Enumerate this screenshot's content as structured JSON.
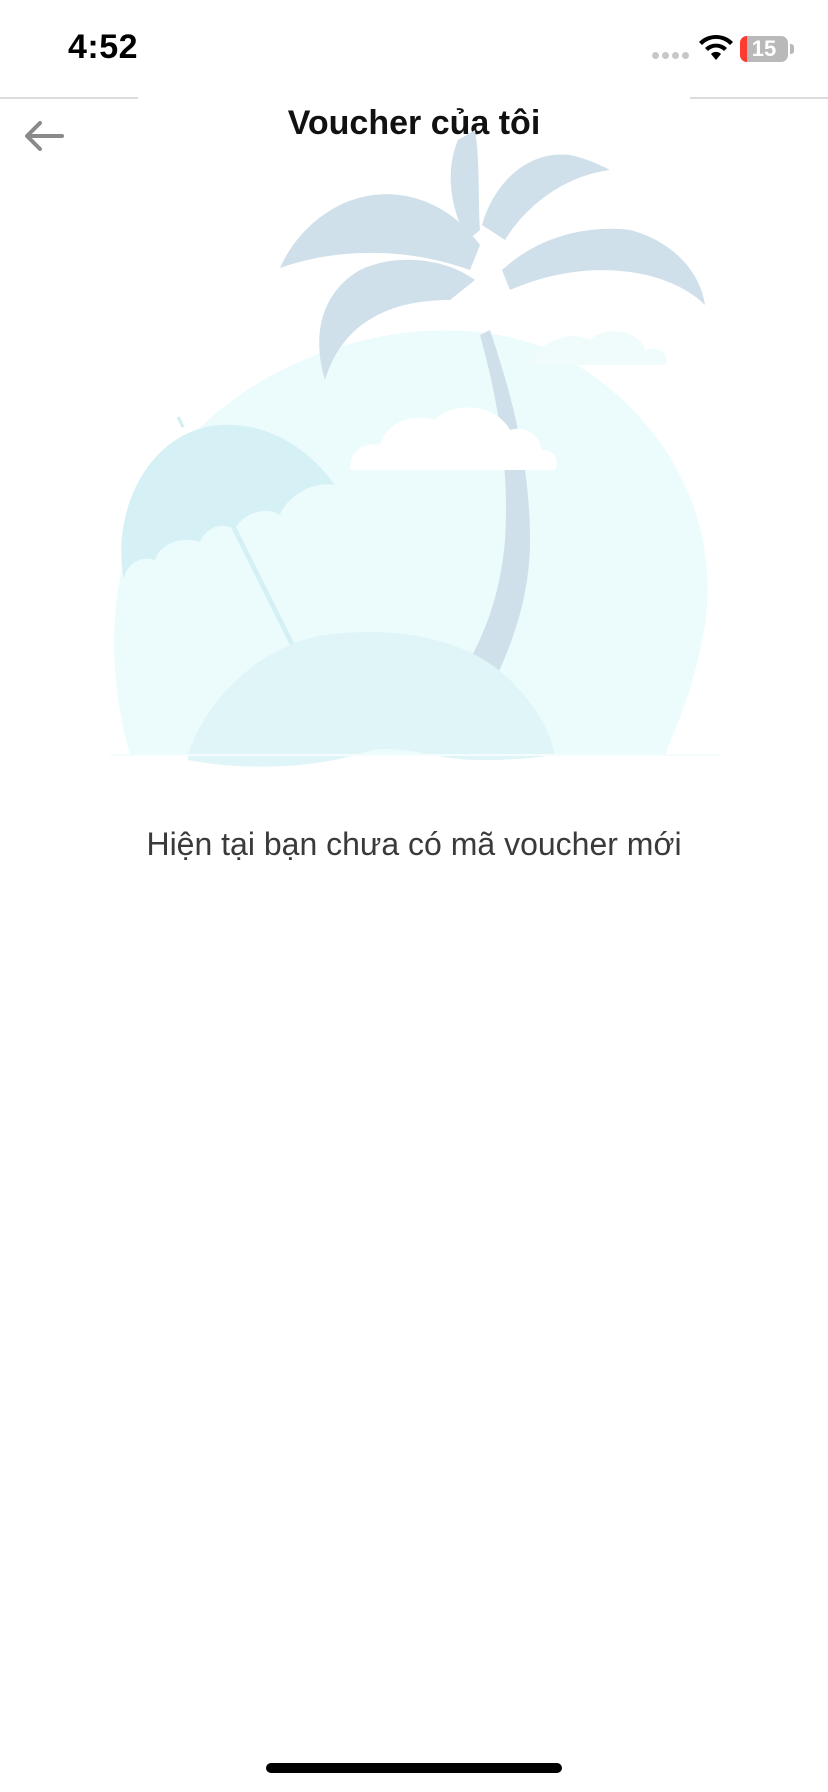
{
  "status_bar": {
    "time": "4:52",
    "battery_level": "15",
    "battery_fraction": 0.15,
    "icons": [
      "signal-dots-icon",
      "wifi-icon",
      "battery-icon"
    ]
  },
  "header": {
    "title": "Voucher của tôi",
    "back_icon": "arrow-left-icon"
  },
  "empty_state": {
    "illustration": "beach-palm-tree-illustration",
    "message": "Hiện tại bạn chưa có mã voucher mới"
  },
  "colors": {
    "palm": "#cfe0ea",
    "sun_circle": "#ecfcfd",
    "umbrella": "#d8f3f6",
    "sand": "#e0f5f8",
    "cloud": "#ffffff",
    "battery_low": "#ff3b30"
  }
}
